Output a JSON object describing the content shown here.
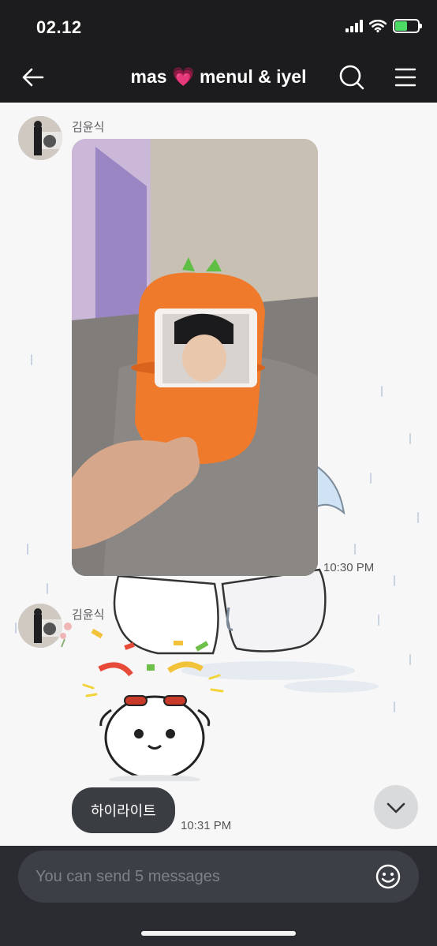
{
  "status_bar": {
    "time": "02.12"
  },
  "header": {
    "title": "mas 💗 menul & iyel"
  },
  "messages": [
    {
      "sender": "김윤식",
      "time": "10:30 PM"
    },
    {
      "sender": "김윤식",
      "time": "10:31 PM",
      "text": "하이라이트"
    }
  ],
  "composer": {
    "placeholder": "You can send 5 messages"
  },
  "colors": {
    "accent_orange": "#f07a2c",
    "bubble": "#3a3d42",
    "header_bg": "#1c1c1e"
  },
  "icons": [
    "back-arrow-icon",
    "search-icon",
    "menu-icon",
    "chevron-down-icon",
    "emoji-icon"
  ]
}
